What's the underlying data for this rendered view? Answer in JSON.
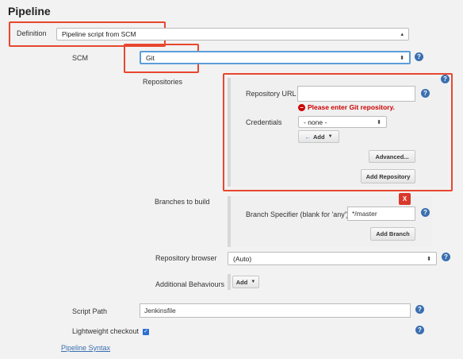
{
  "page_title": "Pipeline",
  "definition": {
    "label": "Definition",
    "value": "Pipeline script from SCM"
  },
  "scm": {
    "label": "SCM",
    "value": "Git"
  },
  "repositories": {
    "label": "Repositories",
    "url_label": "Repository URL",
    "url_value": "",
    "error": "Please enter Git repository.",
    "credentials_label": "Credentials",
    "credentials_value": "- none -",
    "add_label": "Add",
    "advanced_label": "Advanced...",
    "add_repository_label": "Add Repository"
  },
  "branches": {
    "label": "Branches to build",
    "delete_label": "X",
    "specifier_label": "Branch Specifier (blank for 'any')",
    "specifier_value": "*/master",
    "add_branch_label": "Add Branch"
  },
  "repository_browser": {
    "label": "Repository browser",
    "value": "(Auto)"
  },
  "additional_behaviours": {
    "label": "Additional Behaviours",
    "add_label": "Add"
  },
  "script_path": {
    "label": "Script Path",
    "value": "Jenkinsfile"
  },
  "lightweight": {
    "label": "Lightweight checkout",
    "checked": true
  },
  "pipeline_syntax_link": "Pipeline Syntax",
  "help_glyph": "?",
  "colors": {
    "highlight": "#e8472f",
    "error": "#cc0000",
    "link": "#3a6fb0",
    "focus": "#5b9dd9"
  }
}
